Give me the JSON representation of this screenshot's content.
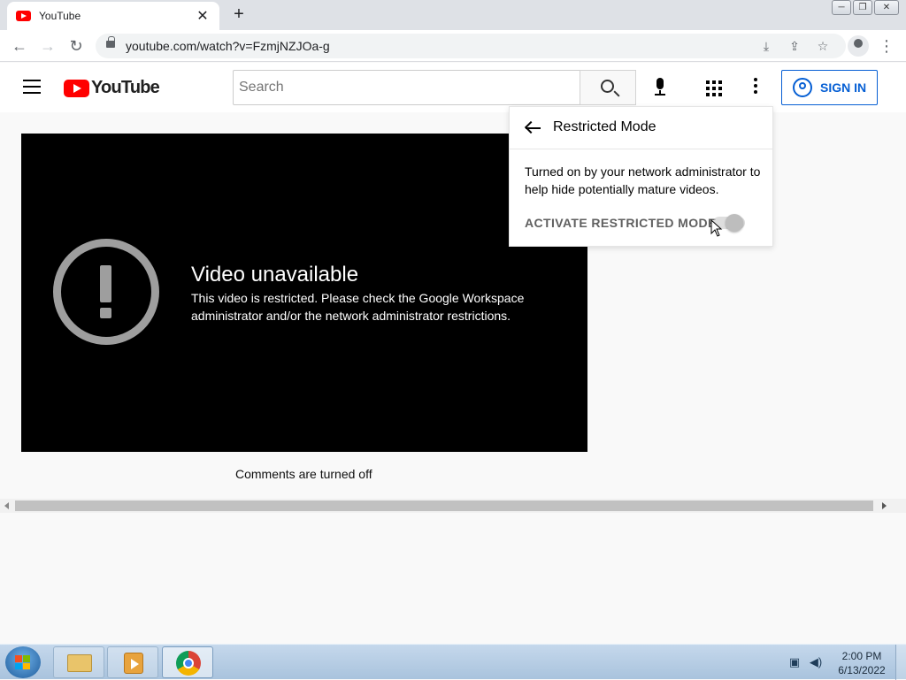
{
  "browser": {
    "tab_title": "YouTube",
    "tab_close": "✕",
    "new_tab": "+",
    "url": "youtube.com/watch?v=FzmjNZJOa-g",
    "window_controls": [
      "─",
      "❐",
      "✕"
    ]
  },
  "youtube": {
    "logo_text": "YouTube",
    "search_placeholder": "Search",
    "signin_label": "SIGN IN",
    "accent_color": "#065fd4",
    "brand_color": "#ff0000"
  },
  "player": {
    "title": "Video unavailable",
    "message": "This video is restricted. Please check the Google Workspace administrator and/or the network administrator restrictions."
  },
  "comments_text": "Comments are turned off",
  "restricted_popup": {
    "title": "Restricted Mode",
    "description": "Turned on by your network administrator to help hide potentially mature videos.",
    "toggle_label": "ACTIVATE RESTRICTED MODE",
    "toggle_state": "on-disabled"
  },
  "taskbar": {
    "time": "2:00 PM",
    "date": "6/13/2022"
  }
}
